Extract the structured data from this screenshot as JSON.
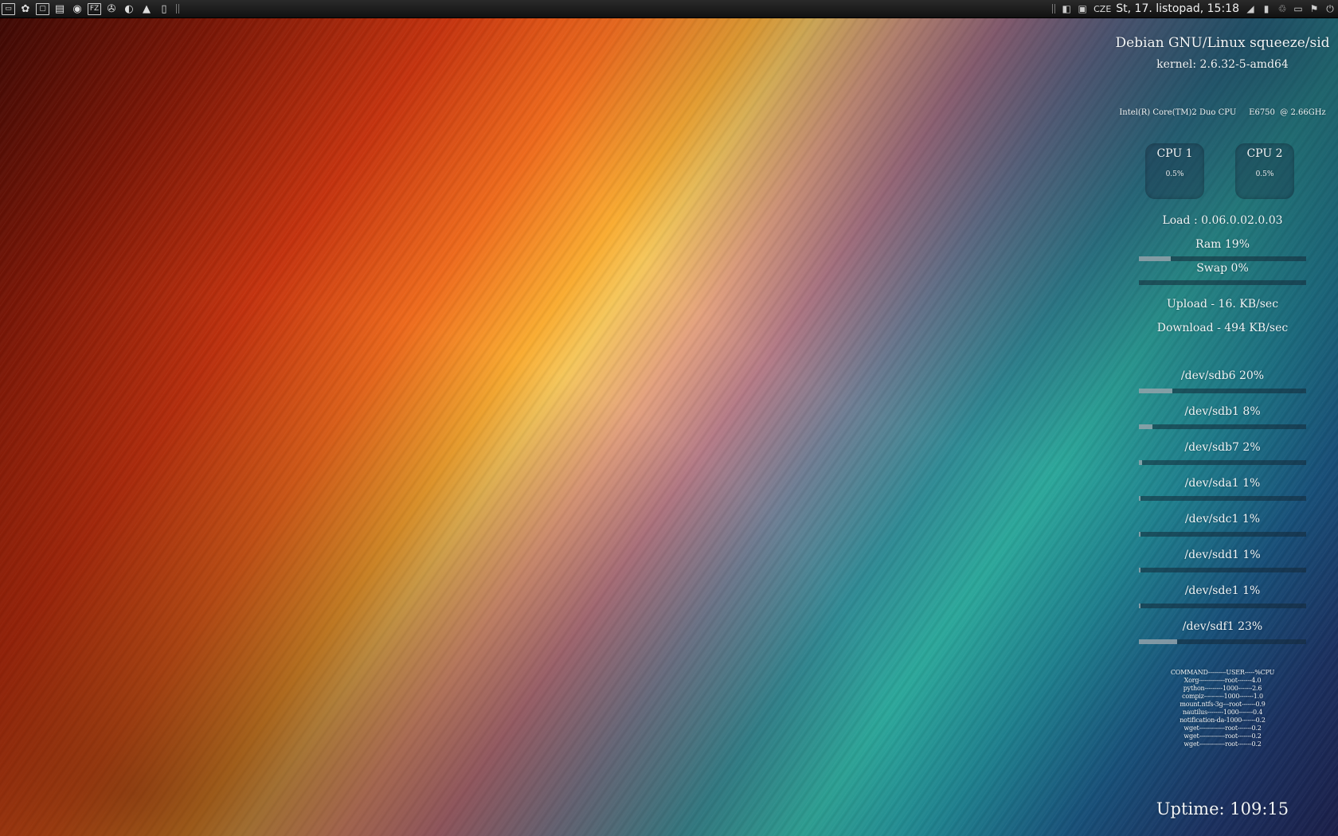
{
  "panel": {
    "launchers": [
      {
        "name": "terminal-icon",
        "glyph": "▭"
      },
      {
        "name": "gimp-icon",
        "glyph": "✿"
      },
      {
        "name": "window-icon",
        "glyph": "▢"
      },
      {
        "name": "file-manager-icon",
        "glyph": "▤"
      },
      {
        "name": "browser-icon",
        "glyph": "◉"
      },
      {
        "name": "filezilla-icon",
        "glyph": "FZ"
      },
      {
        "name": "pidgin-icon",
        "glyph": "✇"
      },
      {
        "name": "disk-icon",
        "glyph": "◐"
      },
      {
        "name": "vlc-icon",
        "glyph": "▲"
      },
      {
        "name": "notes-icon",
        "glyph": "▯"
      }
    ],
    "keyboard_layout": "CZE",
    "clock": "St, 17. listopad, 15:18"
  },
  "conky": {
    "os": "Debian GNU/Linux squeeze/sid",
    "kernel": "kernel: 2.6.32-5-amd64",
    "cpu_model": "Intel(R) Core(TM)2 Duo CPU     E6750  @ 2.66GHz",
    "cpus": [
      {
        "label": "CPU 1",
        "value": "0.5%"
      },
      {
        "label": "CPU 2",
        "value": "0.5%"
      }
    ],
    "load": "Load : 0.06.0.02.0.03",
    "ram": {
      "label": "Ram 19%",
      "percent": 19
    },
    "swap": {
      "label": "Swap 0%",
      "percent": 0
    },
    "upload": "Upload - 16. KB/sec",
    "download": "Download - 494 KB/sec",
    "disks": [
      {
        "label": "/dev/sdb6 20%",
        "percent": 20
      },
      {
        "label": "/dev/sdb1 8%",
        "percent": 8
      },
      {
        "label": "/dev/sdb7 2%",
        "percent": 2
      },
      {
        "label": "/dev/sda1 1%",
        "percent": 1
      },
      {
        "label": "/dev/sdc1 1%",
        "percent": 1
      },
      {
        "label": "/dev/sdd1 1%",
        "percent": 1
      },
      {
        "label": "/dev/sde1 1%",
        "percent": 1
      },
      {
        "label": "/dev/sdf1 23%",
        "percent": 23
      }
    ],
    "processes": [
      "COMMAND---------USER-----%CPU",
      "Xorg-------------root-------4.0",
      "python---------1000-------2.6",
      "compiz----------1000-------1.0",
      "mount.ntfs-3g---root-------0.9",
      "nautilus--------1000-------0.4",
      "notification-da-1000-------0.2",
      "wget-------------root-------0.2",
      "wget-------------root-------0.2",
      "wget-------------root-------0.2"
    ],
    "uptime": "Uptime: 109:15"
  }
}
